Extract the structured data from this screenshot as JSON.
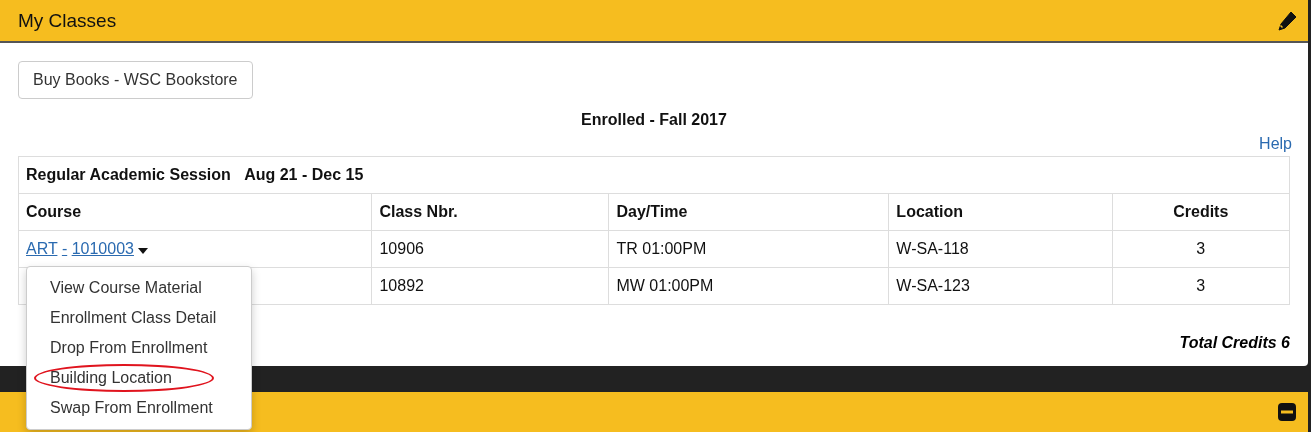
{
  "panel": {
    "title": "My Classes",
    "books_button": "Buy Books - WSC Bookstore",
    "term": "Enrolled - Fall 2017",
    "help": "Help",
    "session": {
      "name": "Regular Academic Session",
      "dates": "Aug 21 - Dec 15"
    },
    "columns": [
      "Course",
      "Class Nbr.",
      "Day/Time",
      "Location",
      "Credits"
    ],
    "rows": [
      {
        "subject": "ART",
        "separator": "-",
        "number": "1010003",
        "class_nbr": "10906",
        "day_time": "TR 01:00PM",
        "location": "W-SA-118",
        "credits": "3"
      },
      {
        "class_nbr": "10892",
        "day_time": "MW 01:00PM",
        "location": "W-SA-123",
        "credits": "3"
      }
    ],
    "total": "Total Credits 6"
  },
  "course_menu": {
    "items": [
      {
        "label": "View Course Material",
        "circled": false
      },
      {
        "label": "Enrollment Class Detail",
        "circled": false
      },
      {
        "label": "Drop From Enrollment",
        "circled": false
      },
      {
        "label": "Building Location",
        "circled": true
      },
      {
        "label": "Swap From Enrollment",
        "circled": false
      }
    ]
  }
}
